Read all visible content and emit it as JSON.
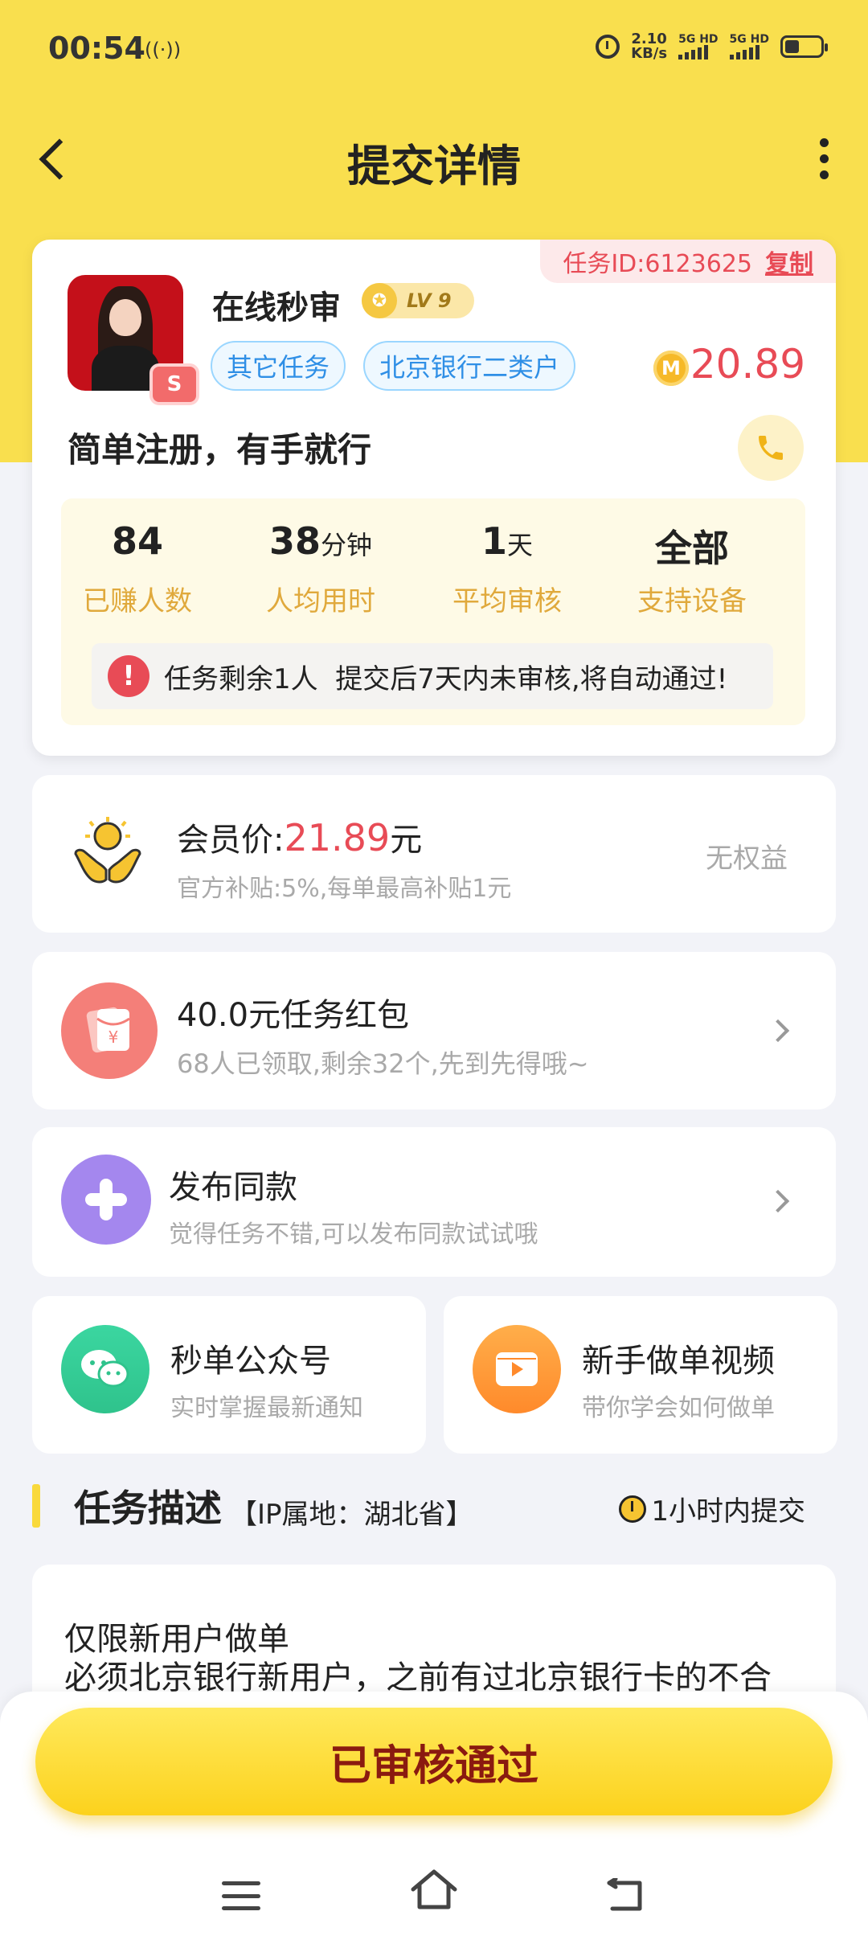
{
  "status_bar": {
    "time": "00:54",
    "net_speed_value": "2.10",
    "net_speed_unit": "KB/s",
    "sim1": "5G HD",
    "sim2": "5G HD"
  },
  "header": {
    "title": "提交详情"
  },
  "task": {
    "task_id_label": "任务ID:6123625",
    "copy_label": "复制",
    "publisher_name": "在线秒审",
    "publisher_level": "LV 9",
    "avatar_badge": "S",
    "tags": [
      "其它任务",
      "北京银行二类户"
    ],
    "reward_coin": "M",
    "reward": "20.89",
    "title": "简单注册，有手就行",
    "stats": [
      {
        "value": "84",
        "unit": "",
        "label": "已赚人数"
      },
      {
        "value": "38",
        "unit": "分钟",
        "label": "人均用时"
      },
      {
        "value": "1",
        "unit": "天",
        "label": "平均审核"
      },
      {
        "value": "全部",
        "unit": "",
        "label": "支持设备"
      }
    ],
    "notice_icon": "!",
    "notice": "任务剩余1人  提交后7天内未审核,将自动通过!"
  },
  "member": {
    "label": "会员价:",
    "price": "21.89",
    "unit": "元",
    "sub": "官方补贴:5%,每单最高补贴1元",
    "right": "无权益"
  },
  "red_packet": {
    "title": "40.0元任务红包",
    "sub": "68人已领取,剩余32个,先到先得哦~"
  },
  "publish_same": {
    "title": "发布同款",
    "sub": "觉得任务不错,可以发布同款试试哦"
  },
  "official_account": {
    "title": "秒单公众号",
    "sub": "实时掌握最新通知"
  },
  "tutorial_video": {
    "title": "新手做单视频",
    "sub": "带你学会如何做单"
  },
  "description": {
    "title": "任务描述",
    "ip": "【IP属地：湖北省】",
    "deadline": "1小时内提交",
    "lines": [
      "仅限新用户做单",
      "必须北京银行新用户，之前有过北京银行卡的不合"
    ]
  },
  "bottom": {
    "status_button": "已审核通过"
  },
  "colors": {
    "header_yellow": "#f9df4e",
    "accent_red": "#e84b56",
    "stat_label": "#e0a93c",
    "tag_blue": "#2f8fe6"
  }
}
